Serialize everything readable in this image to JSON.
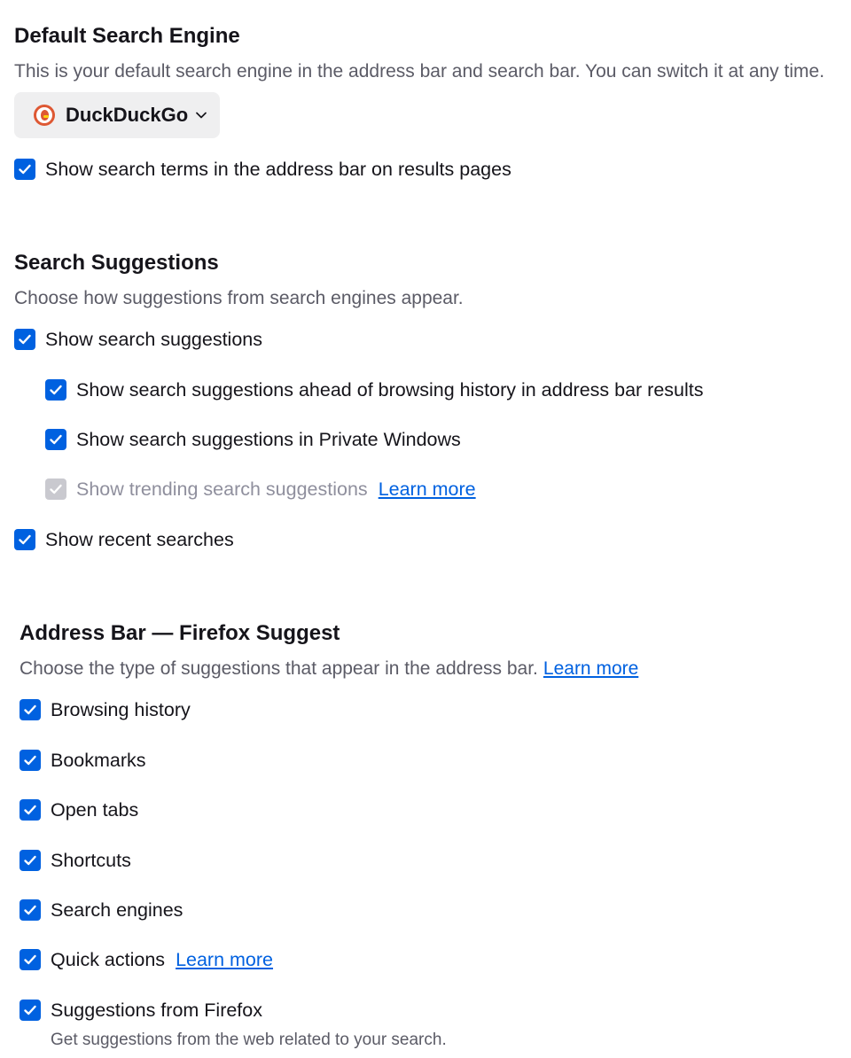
{
  "default_engine": {
    "title": "Default Search Engine",
    "description": "This is your default search engine in the address bar and search bar. You can switch it at any time.",
    "selected_engine": "DuckDuckGo",
    "engine_icon": "duckduckgo-icon",
    "show_terms_label": "Show search terms in the address bar on results pages",
    "show_terms_checked": true
  },
  "suggestions": {
    "title": "Search Suggestions",
    "description": "Choose how suggestions from search engines appear.",
    "show_suggestions": {
      "label": "Show search suggestions",
      "checked": true
    },
    "ahead_of_history": {
      "label": "Show search suggestions ahead of browsing history in address bar results",
      "checked": true
    },
    "private_windows": {
      "label": "Show search suggestions in Private Windows",
      "checked": true
    },
    "trending": {
      "label": "Show trending search suggestions",
      "checked": true,
      "disabled": true,
      "link": "Learn more"
    },
    "recent": {
      "label": "Show recent searches",
      "checked": true
    }
  },
  "firefox_suggest": {
    "title": "Address Bar — Firefox Suggest",
    "description": "Choose the type of suggestions that appear in the address bar.",
    "description_link": "Learn more",
    "items": [
      {
        "label": "Browsing history",
        "checked": true
      },
      {
        "label": "Bookmarks",
        "checked": true
      },
      {
        "label": "Open tabs",
        "checked": true
      },
      {
        "label": "Shortcuts",
        "checked": true
      },
      {
        "label": "Search engines",
        "checked": true
      },
      {
        "label": "Quick actions",
        "checked": true,
        "link": "Learn more"
      },
      {
        "label": "Suggestions from Firefox",
        "checked": true,
        "sublabel": "Get suggestions from the web related to your search."
      }
    ]
  },
  "colors": {
    "accent": "#0061e0",
    "disabled": "#c9c9cf",
    "muted_text": "#5b5b66"
  }
}
